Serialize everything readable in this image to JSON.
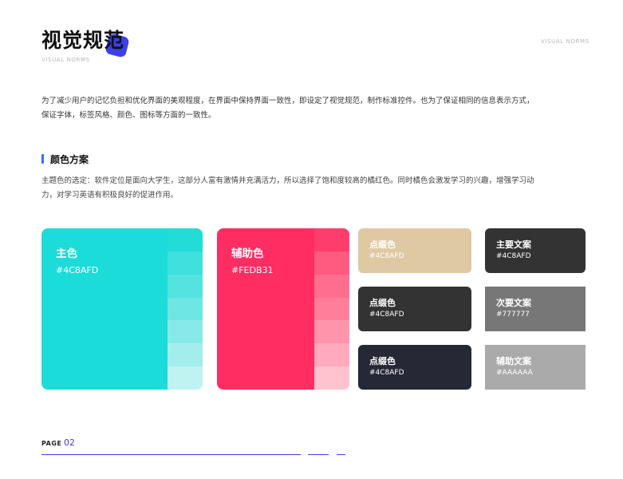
{
  "header": {
    "title": "视觉规范",
    "subtitle": "VISUAL NORMS",
    "top_right": "VISUAL NORMS"
  },
  "intro": "为了减少用户的记忆负担和优化界面的美观程度，在界面中保持界面一致性，即设定了视觉规范，制作标准控件。也为了保证相同的信息表示方式，保证字体，标签风格、颜色、图标等方面的一致性。",
  "section": {
    "title": "颜色方案",
    "description": "主题色的选定：软件定位是面向大学生，这部分人富有激情并充满活力，所以选择了饱和度较高的橘红色。同时橘色会激发学习的兴趣，增强学习动力，对学习英语有积极良好的促进作用。"
  },
  "primary": {
    "name": "主色",
    "code": "#4C8AFD",
    "color": "#1bdcd8",
    "shades": [
      "#22dcd8",
      "#3fe0dd",
      "#55e3e0",
      "#6ee6e3",
      "#88eae8",
      "#a3eeec",
      "#bff3f1"
    ]
  },
  "accent": {
    "name": "辅助色",
    "code": "#FEDB31",
    "color": "#ff2d62",
    "shades": [
      "#ff3d6d",
      "#ff5a80",
      "#ff6e8f",
      "#ff7f9b",
      "#ff94ab",
      "#ffaabd",
      "#ffc2cf"
    ]
  },
  "dots": [
    {
      "name": "点缀色",
      "code": "#4C8AFD",
      "color": "#dfc9a3"
    },
    {
      "name": "点缀色",
      "code": "#4C8AFD",
      "color": "#333333"
    },
    {
      "name": "点缀色",
      "code": "#4C8AFD",
      "color": "#262836"
    }
  ],
  "text_colors": [
    {
      "name": "主要文案",
      "code": "#4C8AFD",
      "color": "#333333"
    },
    {
      "name": "次要文案",
      "code": "#777777",
      "color": "#777777"
    },
    {
      "name": "辅助文案",
      "code": "#AAAAAA",
      "color": "#aaaaaa"
    }
  ],
  "footer": {
    "page_label": "PAGE",
    "page_number": "02"
  }
}
